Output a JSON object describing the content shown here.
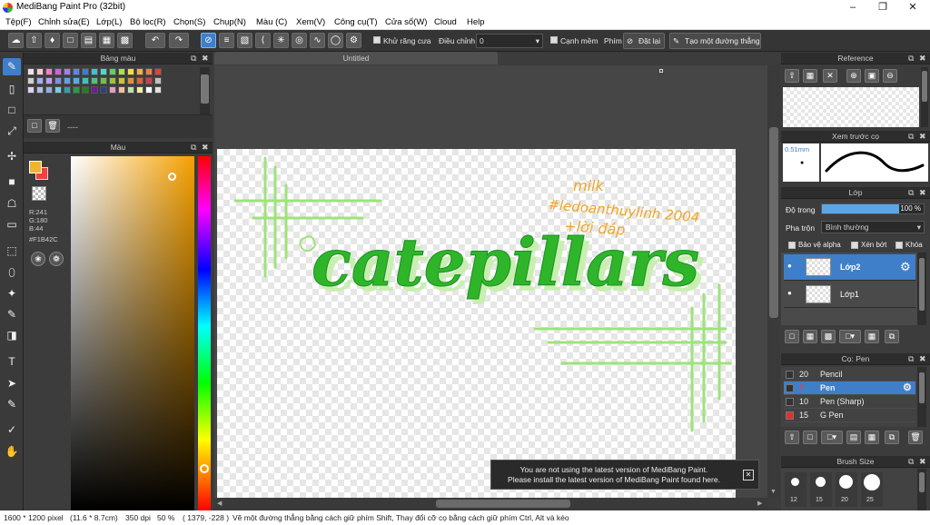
{
  "window": {
    "title": "MediBang Paint Pro (32bit)"
  },
  "menu": [
    "Tệp(F)",
    "Chỉnh sửa(E)",
    "Lớp(L)",
    "Bộ lọc(R)",
    "Chọn(S)",
    "Chụp(N)",
    "Màu (C)",
    "Xem(V)",
    "Công cụ(T)",
    "Cửa sổ(W)",
    "Cloud",
    "Help"
  ],
  "toolbar": {
    "antialias_label": "Khử răng cưa",
    "correction_label": "Điều chỉnh",
    "correction_value": "0",
    "edge_label": "Cạnh mềm",
    "key_label": "Phím",
    "reset_label": "Đặt lại",
    "line_label": "Tạo một đường thẳng"
  },
  "palette": {
    "title": "Bảng màu",
    "placeholder": "----",
    "colors": [
      "#f0e0e8",
      "#f8c8d8",
      "#f080c0",
      "#d060e0",
      "#a080f0",
      "#6080f0",
      "#3080e0",
      "#40c0e0",
      "#40e0c0",
      "#60d060",
      "#b0e040",
      "#f0e040",
      "#f0b040",
      "#f08040",
      "#e04040",
      "#d0d0d0",
      "#a0b0f0",
      "#c0a0f0",
      "#8090e0",
      "#60a0e0",
      "#50b0e0",
      "#40c0c0",
      "#50c080",
      "#70c050",
      "#a0c040",
      "#d0c040",
      "#e09040",
      "#e06040",
      "#d04050",
      "#c0c0c0",
      "#e0d0f0",
      "#b0c0e0",
      "#90b0e0",
      "#70d0e0",
      "#30a0a0",
      "#20a040",
      "#208020",
      "#6a2090",
      "#304080",
      "#e0a0c0",
      "#f0c0a0",
      "#c0e0b0",
      "#f0f0a0",
      "#ffffff",
      "#e0e0e0"
    ]
  },
  "color_panel": {
    "title": "Màu",
    "r": "R:241",
    "g": "G:180",
    "b": "B:44",
    "hex": "#F1B42C",
    "primary": "#f1b42c",
    "secondary": "#f04040"
  },
  "document": {
    "tab": "Untitled",
    "artwork": {
      "word": "catepillars",
      "sig1": "milk",
      "sig2": "#ledoanthuylinh 2004",
      "sig3": "+lời đáp"
    }
  },
  "notification": {
    "line1": "You are not using the latest version of MediBang Paint.",
    "line2": "Please install the latest version of MediBang Paint found here."
  },
  "reference": {
    "title": "Reference"
  },
  "preview": {
    "title": "Xem trước cọ",
    "size": "0.51mm"
  },
  "layers": {
    "title": "Lớp",
    "opacity_label": "Độ trong",
    "opacity_value": "100 %",
    "blend_label": "Pha trộn",
    "blend_value": "Bình thường",
    "protect_alpha": "Bảo vệ alpha",
    "clipping": "Xén bớt",
    "lock": "Khóa",
    "items": [
      {
        "name": "Lớp2",
        "selected": true
      },
      {
        "name": "Lớp1",
        "selected": false
      }
    ]
  },
  "brushes": {
    "title": "Cọ: Pen",
    "items": [
      {
        "size": "20",
        "name": "Pencil",
        "color": "#333333"
      },
      {
        "size": "7",
        "name": "Pen",
        "color": "#333333",
        "selected": true
      },
      {
        "size": "10",
        "name": "Pen (Sharp)",
        "color": "#333333"
      },
      {
        "size": "15",
        "name": "G Pen",
        "color": "#e03030"
      }
    ]
  },
  "brush_size": {
    "title": "Brush Size",
    "sizes": [
      "12",
      "15",
      "20",
      "25"
    ]
  },
  "status": {
    "dimensions": "1600 * 1200 pixel",
    "cm": "(11.6 * 8.7cm)",
    "dpi": "350 dpi",
    "zoom": "50 %",
    "coords": "( 1379, -228 )",
    "hint": "Vẽ một đường thẳng bằng cách giữ phím Shift, Thay đổi cỡ cọ bằng cách giữ phím Ctrl, Alt và kéo"
  }
}
